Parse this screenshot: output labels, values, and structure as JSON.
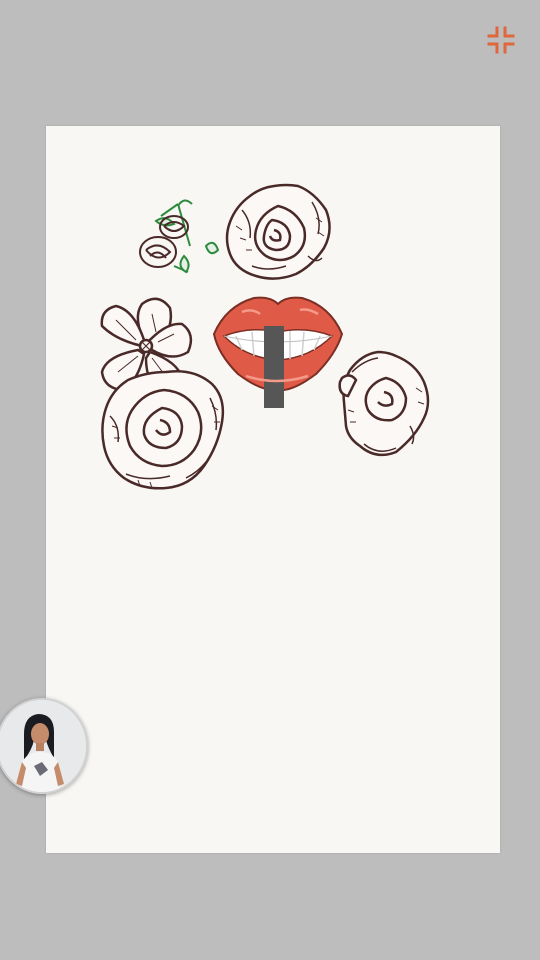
{
  "toolbar": {
    "exit_fullscreen_icon": "exit-fullscreen-icon",
    "accent_color": "#e0673a"
  },
  "artboard": {
    "background": "#f8f7f4",
    "elements": [
      "flower-buds-sketch",
      "rose-sketch",
      "five-petal-flower-sketch",
      "lips-sticker",
      "large-rose-sketch",
      "small-rose-sketch"
    ]
  },
  "presenter": {
    "icon": "presenter-avatar"
  }
}
